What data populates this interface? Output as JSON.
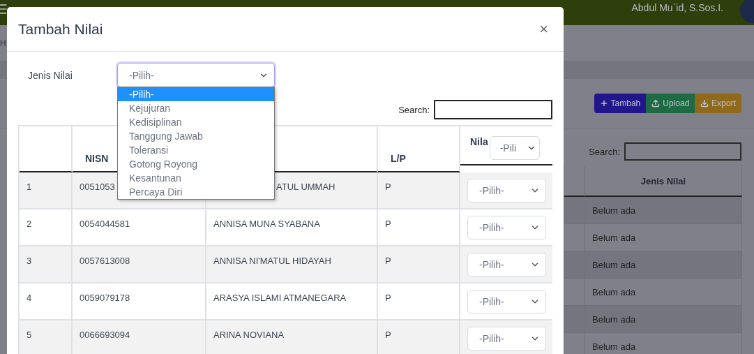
{
  "background_page": {
    "user_name": "Abdul Mu`id, S.Sos.I.",
    "breadcrumb": "H",
    "buttons": [
      {
        "label": "Tambah",
        "kind": "add"
      },
      {
        "label": "Upload",
        "kind": "upload"
      },
      {
        "label": "Export",
        "kind": "export"
      }
    ],
    "search_label": "Search:",
    "table": {
      "columns": [
        "Jenis Nilai"
      ],
      "rows": [
        "Belum ada",
        "Belum ada",
        "Belum ada",
        "Belum ada",
        "Belum ada",
        "Belum ada"
      ]
    }
  },
  "modal": {
    "title": "Tambah Nilai",
    "close": "×",
    "jenis_nilai": {
      "label": "Jenis Nilai",
      "value": "-Pilih-",
      "expanded": true,
      "options": [
        {
          "label": "-Pilih-",
          "selected": true
        },
        {
          "label": "Kejujuran",
          "selected": false
        },
        {
          "label": "Kedisiplinan",
          "selected": false
        },
        {
          "label": "Tanggung Jawab",
          "selected": false
        },
        {
          "label": "Toleransi",
          "selected": false
        },
        {
          "label": "Gotong Royong",
          "selected": false
        },
        {
          "label": "Kesantunan",
          "selected": false
        },
        {
          "label": "Percaya Diri",
          "selected": false
        }
      ]
    },
    "search_label": "Search:",
    "table": {
      "header": {
        "nisn": "NISN",
        "lp": "L/P",
        "nilai": "Nila",
        "nilai_filter": "-Pili"
      },
      "rows": [
        {
          "no": "1",
          "nisn": "0051053",
          "name": "ATUL UMMAH",
          "lp": "P",
          "nilai": "-Pilih-"
        },
        {
          "no": "2",
          "nisn": "0054044581",
          "name": "ANNISA MUNA SYABANA",
          "lp": "P",
          "nilai": "-Pilih-"
        },
        {
          "no": "3",
          "nisn": "0057613008",
          "name": "ANNISA NI'MATUL HIDAYAH",
          "lp": "P",
          "nilai": "-Pilih-"
        },
        {
          "no": "4",
          "nisn": "0059079178",
          "name": "ARASYA ISLAMI ATMANEGARA",
          "lp": "P",
          "nilai": "-Pilih-"
        },
        {
          "no": "5",
          "nisn": "0066693094",
          "name": "ARINA NOVIANA",
          "lp": "P",
          "nilai": "-Pilih-"
        }
      ]
    }
  }
}
